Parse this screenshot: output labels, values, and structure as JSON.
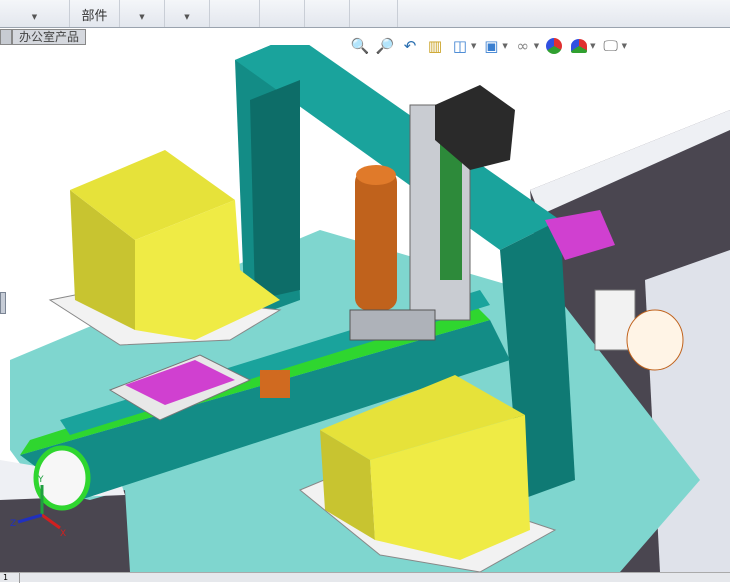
{
  "ribbon": {
    "groups": [
      {
        "label": "",
        "has_dropdown": true
      },
      {
        "label": "部件",
        "has_dropdown": false
      },
      {
        "label": "",
        "has_dropdown": true
      },
      {
        "label": "",
        "has_dropdown": true
      },
      {
        "label": "",
        "has_dropdown": false
      },
      {
        "label": "",
        "has_dropdown": false
      },
      {
        "label": "",
        "has_dropdown": false
      },
      {
        "label": "",
        "has_dropdown": false
      }
    ]
  },
  "document_tab": {
    "label": "办公室产品"
  },
  "headsup_toolbar": {
    "icons": [
      "zoom-to-fit-icon",
      "zoom-to-area-icon",
      "previous-view-icon",
      "section-view-icon",
      "view-orientation-icon",
      "display-style-icon",
      "hide-show-items-icon",
      "edit-appearance-icon",
      "apply-scene-icon",
      "view-settings-icon"
    ]
  },
  "triad": {
    "x": "X",
    "y": "Y",
    "z": "Z",
    "x_color": "#d02020",
    "y_color": "#20a040",
    "z_color": "#2030c0"
  },
  "status_bar": {
    "cell": "1"
  },
  "colors": {
    "teal": "#138c86",
    "yellow": "#e6e23a",
    "cyan": "#7fd6cf",
    "grey_dark": "#4a4650",
    "belt_green": "#2fd62f",
    "magenta": "#d040d0"
  }
}
